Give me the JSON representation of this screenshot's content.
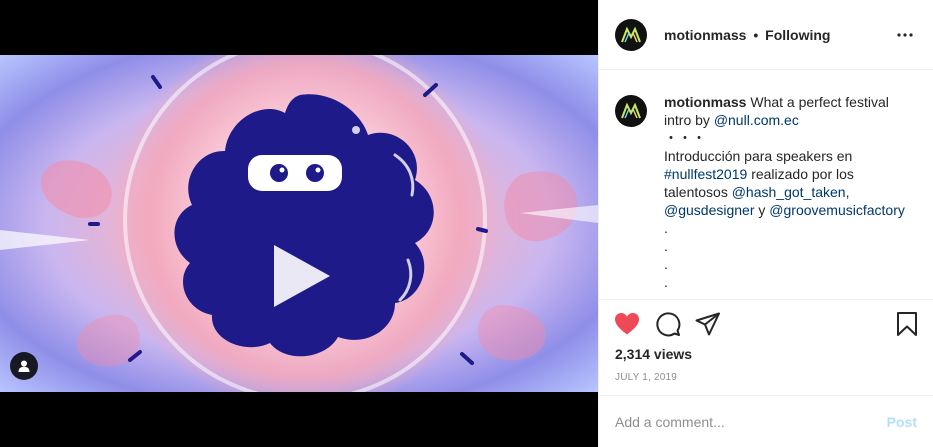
{
  "header": {
    "username": "motionmass",
    "separator": "•",
    "follow_status": "Following"
  },
  "caption": {
    "username": "motionmass",
    "text_intro": "What a perfect festival intro by",
    "mention_org": "@null.com.ec",
    "ellipsis": "・・・",
    "line_es_1": "Introducción para speakers en",
    "hashtag": "#nullfest2019",
    "line_es_2": "realizado por los",
    "line_es_3": "talentosos",
    "mention_1": "@hash_got_taken",
    "comma": ",",
    "mention_2": "@gusdesigner",
    "conj": "y",
    "mention_3": "@groovemusicfactory",
    "dots": [
      ".",
      ".",
      ".",
      "."
    ]
  },
  "stats": {
    "views": "2,314 views",
    "date": "JULY 1, 2019"
  },
  "comment_box": {
    "placeholder": "Add a comment...",
    "post_label": "Post"
  },
  "colors": {
    "like": "#ed4956",
    "link": "#00376b",
    "post_disabled": "#b2dffc",
    "blob": "#1f1a8a"
  },
  "icons": [
    "more-options-icon",
    "heart-icon",
    "comment-icon",
    "share-icon",
    "bookmark-icon",
    "play-icon",
    "user-tag-icon",
    "logo-icon"
  ]
}
